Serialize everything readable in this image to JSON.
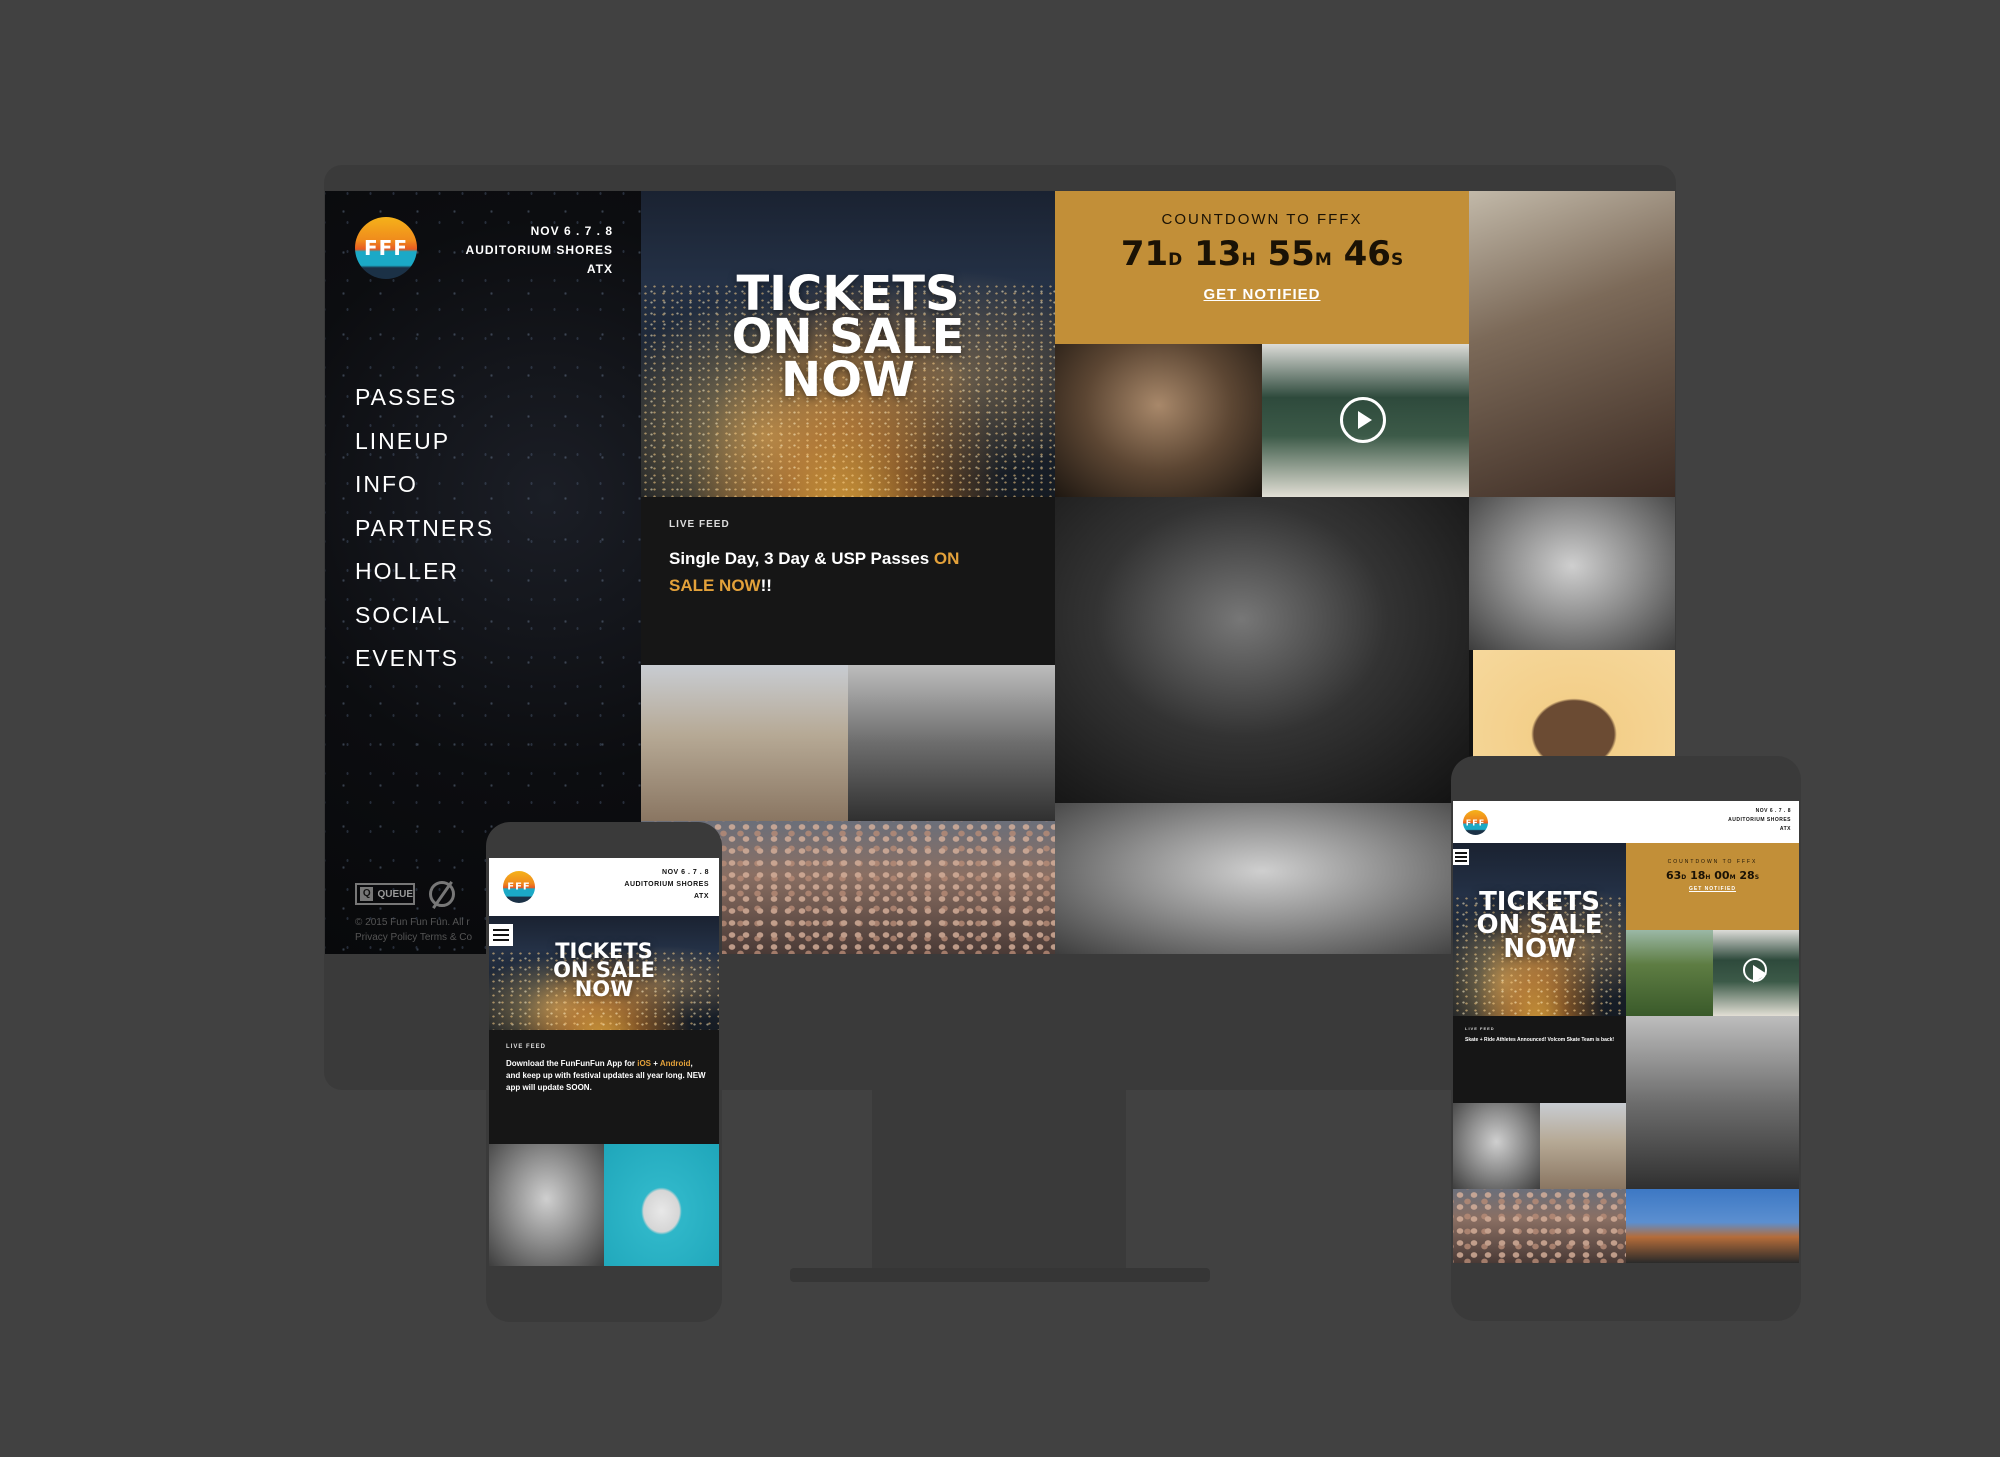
{
  "desktop": {
    "logo_text": "FFF",
    "dates": [
      "NOV 6 . 7 . 8",
      "AUDITORIUM SHORES",
      "ATX"
    ],
    "nav": [
      "PASSES",
      "LINEUP",
      "INFO",
      "PARTNERS",
      "HOLLER",
      "SOCIAL",
      "EVENTS"
    ],
    "hero_lines": [
      "TICKETS",
      "ON SALE",
      "NOW"
    ],
    "countdown": {
      "title": "COUNTDOWN TO FFFX",
      "days": "71",
      "days_unit": "D",
      "hours": "13",
      "hours_unit": "H",
      "minutes": "55",
      "minutes_unit": "M",
      "seconds": "46",
      "seconds_unit": "S",
      "cta": "GET NOTIFIED"
    },
    "feed": {
      "label": "LIVE FEED",
      "text_plain": "Single Day, 3 Day & USP Passes ",
      "text_highlight": "ON SALE NOW",
      "text_tail": "!!"
    },
    "partner_queue": "QUEUE",
    "footer_line1": "© 2015 Fun Fun Fun. All r",
    "footer_line2": "Privacy Policy  Terms & Co"
  },
  "phone": {
    "logo_text": "FFF",
    "dates": [
      "NOV 6 . 7 . 8",
      "AUDITORIUM SHORES",
      "ATX"
    ],
    "hero_lines": [
      "TICKETS",
      "ON SALE",
      "NOW"
    ],
    "feed": {
      "label": "LIVE FEED",
      "text_a": "Download the FunFunFun App for ",
      "ios": "iOS",
      "text_b": " + ",
      "android": "Android",
      "text_c": ", and keep up with festival updates all year long. NEW app will update SOON."
    }
  },
  "tablet": {
    "logo_text": "FFF",
    "dates": [
      "NOV 6 . 7 . 8",
      "AUDITORIUM SHORES",
      "ATX"
    ],
    "hero_lines": [
      "TICKETS",
      "ON SALE",
      "NOW"
    ],
    "countdown": {
      "title": "COUNTDOWN TO FFFX",
      "days": "63",
      "days_unit": "D",
      "hours": "18",
      "hours_unit": "H",
      "minutes": "00",
      "minutes_unit": "M",
      "seconds": "28",
      "seconds_unit": "S",
      "cta": "GET NOTIFIED"
    },
    "feed": {
      "label": "LIVE FEED",
      "text": "Skate + Ride Athletes Announced! Volcom Skate Team is back!"
    }
  },
  "colors": {
    "background": "#414141",
    "accent_gold": "#c28f38",
    "highlight_orange": "#e3a13a"
  }
}
